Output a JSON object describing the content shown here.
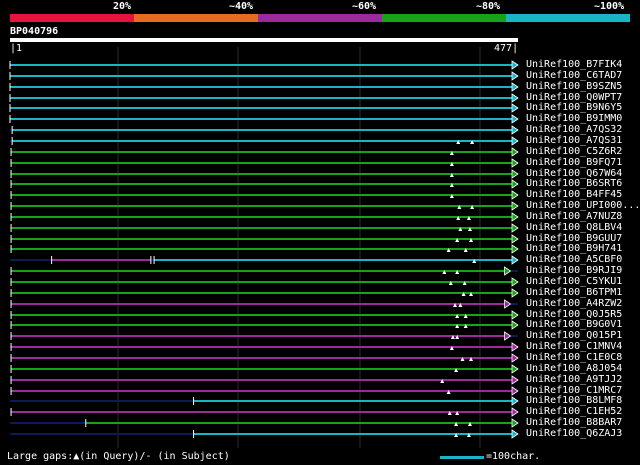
{
  "legend": {
    "labels": [
      "20%",
      "~40%",
      "~60%",
      "~80%",
      "~100%"
    ],
    "colors": [
      "#e8123c",
      "#e36f1e",
      "#9c2a9c",
      "#17a317",
      "#1ab3c8"
    ]
  },
  "query": {
    "id": "BP040796",
    "start": "1",
    "end": "477",
    "length": 477
  },
  "hits": [
    {
      "label": "UniRef100_B7FIK4",
      "start": 1,
      "end": 477,
      "color": "#1ab3c8",
      "gaps": []
    },
    {
      "label": "UniRef100_C6TAD7",
      "start": 1,
      "end": 477,
      "color": "#1ab3c8",
      "gaps": []
    },
    {
      "label": "UniRef100_B9SZN5",
      "start": 1,
      "end": 477,
      "color": "#1ab3c8",
      "gaps": []
    },
    {
      "label": "UniRef100_Q0WPT7",
      "start": 1,
      "end": 477,
      "color": "#1ab3c8",
      "gaps": []
    },
    {
      "label": "UniRef100_B9N6Y5",
      "start": 1,
      "end": 477,
      "color": "#1ab3c8",
      "gaps": []
    },
    {
      "label": "UniRef100_B9IMM0",
      "start": 1,
      "end": 477,
      "color": "#1ab3c8",
      "gaps": []
    },
    {
      "label": "UniRef100_A7QS32",
      "start": 3,
      "end": 477,
      "color": "#1ab3c8",
      "gaps": []
    },
    {
      "label": "UniRef100_A7QS31",
      "start": 3,
      "end": 477,
      "color": "#1ab3c8",
      "gaps": [
        421,
        434
      ]
    },
    {
      "label": "UniRef100_C5Z6R2",
      "start": 2,
      "end": 477,
      "color": "#17a317",
      "gaps": [
        415
      ]
    },
    {
      "label": "UniRef100_B9FQ71",
      "start": 2,
      "end": 477,
      "color": "#17a317",
      "gaps": [
        415
      ]
    },
    {
      "label": "UniRef100_Q67W64",
      "start": 2,
      "end": 477,
      "color": "#17a317",
      "gaps": [
        415
      ]
    },
    {
      "label": "UniRef100_B6SRT6",
      "start": 2,
      "end": 477,
      "color": "#17a317",
      "gaps": [
        415
      ]
    },
    {
      "label": "UniRef100_B4FF45",
      "start": 2,
      "end": 477,
      "color": "#17a317",
      "gaps": [
        415
      ]
    },
    {
      "label": "UniRef100_UPI000...",
      "start": 2,
      "end": 477,
      "color": "#17a317",
      "gaps": [
        422,
        434
      ]
    },
    {
      "label": "UniRef100_A7NUZ8",
      "start": 2,
      "end": 477,
      "color": "#17a317",
      "gaps": [
        421,
        431
      ]
    },
    {
      "label": "UniRef100_Q8LBV4",
      "start": 2,
      "end": 477,
      "color": "#17a317",
      "gaps": [
        423,
        432
      ]
    },
    {
      "label": "UniRef100_B9GUU7",
      "start": 2,
      "end": 477,
      "color": "#17a317",
      "gaps": [
        420,
        433
      ]
    },
    {
      "label": "UniRef100_B9H741",
      "start": 2,
      "end": 477,
      "color": "#17a317",
      "gaps": [
        412,
        428
      ]
    },
    {
      "label": "UniRef100_A5CBF0",
      "start": 40,
      "end": 477,
      "color": "#1ab3c8",
      "subject_gap": [
        133,
        136
      ],
      "gap_segment_color": "#9c2a9c",
      "gaps": [
        436
      ]
    },
    {
      "label": "UniRef100_B9RJI9",
      "start": 2,
      "end": 470,
      "color": "#17a317",
      "gaps": [
        408,
        420
      ]
    },
    {
      "label": "UniRef100_C5YKU1",
      "start": 2,
      "end": 477,
      "color": "#17a317",
      "gaps": [
        414,
        427
      ]
    },
    {
      "label": "UniRef100_B6TPM1",
      "start": 2,
      "end": 477,
      "color": "#17a317",
      "gaps": [
        426,
        433
      ]
    },
    {
      "label": "UniRef100_A4RZW2",
      "start": 2,
      "end": 470,
      "color": "#9c2a9c",
      "gaps": [
        418,
        423
      ]
    },
    {
      "label": "UniRef100_Q0J5R5",
      "start": 2,
      "end": 477,
      "color": "#17a317",
      "gaps": [
        420,
        428
      ]
    },
    {
      "label": "UniRef100_B9G0V1",
      "start": 2,
      "end": 477,
      "color": "#17a317",
      "gaps": [
        420,
        428
      ]
    },
    {
      "label": "UniRef100_Q015P1",
      "start": 2,
      "end": 470,
      "color": "#9c2a9c",
      "gaps": [
        416,
        420
      ]
    },
    {
      "label": "UniRef100_C1MNV4",
      "start": 2,
      "end": 477,
      "color": "#9c2a9c",
      "gaps": [
        415
      ]
    },
    {
      "label": "UniRef100_C1E0C8",
      "start": 2,
      "end": 477,
      "color": "#9c2a9c",
      "gaps": [
        425,
        433
      ]
    },
    {
      "label": "UniRef100_A8J054",
      "start": 2,
      "end": 477,
      "color": "#17a317",
      "gaps": [
        419
      ]
    },
    {
      "label": "UniRef100_A9TJJ2",
      "start": 2,
      "end": 477,
      "color": "#9c2a9c",
      "gaps": [
        406
      ]
    },
    {
      "label": "UniRef100_C1MRC7",
      "start": 2,
      "end": 477,
      "color": "#9c2a9c",
      "gaps": [
        412
      ]
    },
    {
      "label": "UniRef100_B8LMF8",
      "start": 173,
      "end": 477,
      "color": "#1ab3c8",
      "gaps": []
    },
    {
      "label": "UniRef100_C1EH52",
      "start": 2,
      "end": 477,
      "color": "#9c2a9c",
      "gaps": [
        413,
        420
      ]
    },
    {
      "label": "UniRef100_B8BAR7",
      "start": 72,
      "end": 477,
      "color": "#17a317",
      "gaps": [
        419,
        432
      ]
    },
    {
      "label": "UniRef100_Q6ZAJ3",
      "start": 173,
      "end": 477,
      "color": "#1ab3c8",
      "gaps": [
        419,
        431
      ]
    }
  ],
  "footer": {
    "gaps_text": "Large gaps:▲(in Query)/- (in Subject)",
    "scale_text": "=100char.",
    "scale_color": "#1ab3c8"
  }
}
